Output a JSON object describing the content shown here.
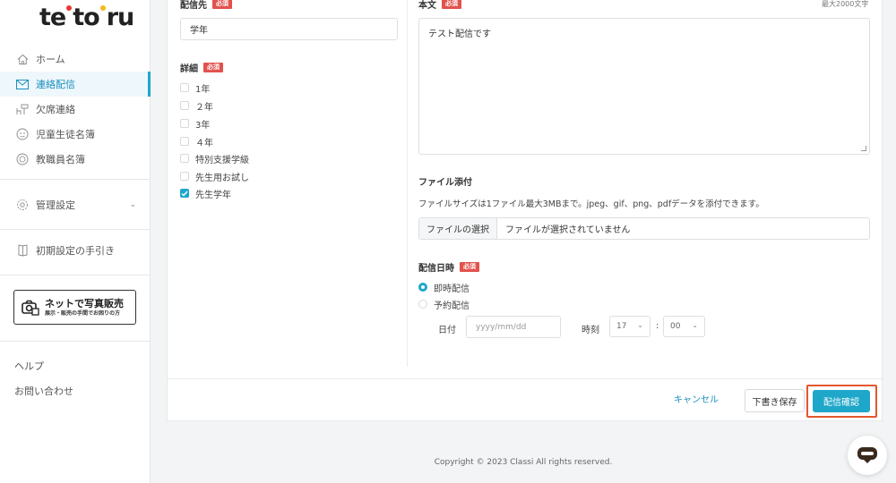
{
  "brand": {
    "logo_text": "tetoru",
    "dot_colors": [
      "#e8382f",
      "#f5b919",
      "#2bb673"
    ]
  },
  "sidebar": {
    "items": [
      {
        "label": "ホーム",
        "icon": "home-icon"
      },
      {
        "label": "連絡配信",
        "icon": "mail-icon",
        "active": true
      },
      {
        "label": "欠席連絡",
        "icon": "desk-icon"
      },
      {
        "label": "児童生徒名簿",
        "icon": "student-icon"
      },
      {
        "label": "教職員名簿",
        "icon": "teacher-icon"
      }
    ],
    "settings_label": "管理設定",
    "guide_label": "初期設定の手引き",
    "promo": {
      "title": "ネットで写真販売",
      "subtitle": "展示・販売の手間でお困りの方"
    },
    "help_label": "ヘルプ",
    "contact_label": "お問い合わせ"
  },
  "form": {
    "recipient": {
      "label": "配信先",
      "required": "必須",
      "value": "学年"
    },
    "detail": {
      "label": "詳細",
      "required": "必須",
      "options": [
        {
          "label": "1年",
          "checked": false
        },
        {
          "label": "２年",
          "checked": false
        },
        {
          "label": "3年",
          "checked": false
        },
        {
          "label": "４年",
          "checked": false
        },
        {
          "label": "特別支援学級",
          "checked": false
        },
        {
          "label": "先生用お試し",
          "checked": false
        },
        {
          "label": "先生学年",
          "checked": true
        }
      ]
    },
    "body": {
      "label": "本文",
      "required": "必須",
      "max_chars": "最大2000文字",
      "value": "テスト配信です"
    },
    "attachment": {
      "label": "ファイル添付",
      "note": "ファイルサイズは1ファイル最大3MBまで。jpeg、gif、png、pdfデータを添付できます。",
      "button": "ファイルの選択",
      "status": "ファイルが選択されていません"
    },
    "schedule": {
      "label": "配信日時",
      "required": "必須",
      "option_now": "即時配信",
      "option_later": "予約配信",
      "selected": "即時配信",
      "date_label": "日付",
      "date_placeholder": "yyyy/mm/dd",
      "time_label": "時刻",
      "hour": "17",
      "colon": ":",
      "minute": "00"
    }
  },
  "actions": {
    "cancel": "キャンセル",
    "draft": "下書き保存",
    "confirm": "配信確認"
  },
  "footer": {
    "copyright": "Copyright © 2023 Classi All rights reserved."
  },
  "colors": {
    "accent": "#1ea7c9",
    "required": "#e2524d",
    "highlight": "#e4572e"
  }
}
